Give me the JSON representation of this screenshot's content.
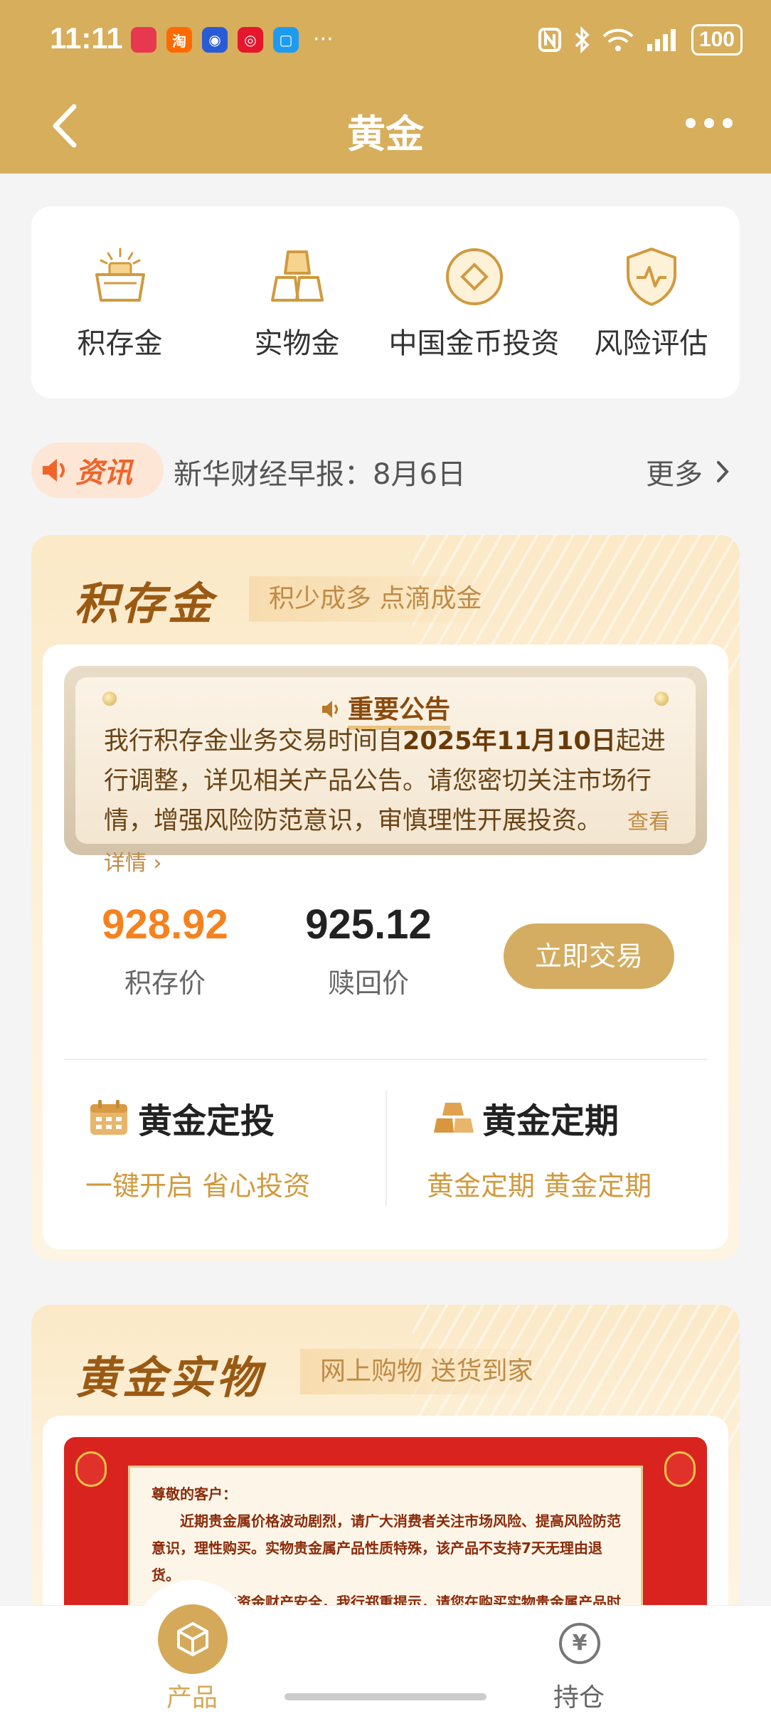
{
  "status_bar": {
    "time": "11:11",
    "apps": [
      {
        "icon": "huawei-app-icon",
        "glyph": "",
        "color": "#e8384f"
      },
      {
        "icon": "taobao-icon",
        "glyph": "淘",
        "color": "#ff6a00"
      },
      {
        "icon": "baidu-icon",
        "glyph": "◉",
        "color": "#2a5bd7"
      },
      {
        "icon": "weibo-icon",
        "glyph": "◎",
        "color": "#e6162d"
      },
      {
        "icon": "message-icon",
        "glyph": "▢",
        "color": "#1e9bf0"
      }
    ],
    "overflow": "···",
    "battery": "100"
  },
  "header": {
    "title": "黄金"
  },
  "quick_menu": [
    {
      "label": "积存金",
      "icon": "gold-basket-icon"
    },
    {
      "label": "实物金",
      "icon": "gold-bars-icon"
    },
    {
      "label": "中国金币投资",
      "icon": "gold-coin-icon"
    },
    {
      "label": "风险评估",
      "icon": "shield-pulse-icon"
    }
  ],
  "news": {
    "tag": "资讯",
    "headline": "新华财经早报：8月6日",
    "more": "更多"
  },
  "accumulation": {
    "title": "积存金",
    "subtitle": "积少成多 点滴成金",
    "notice": {
      "title": "重要公告",
      "text_before": "我行积存金业务交易时间自",
      "text_bold": "2025年11月10日",
      "text_after": "起进行调整，详见相关产品公告。请您密切关注市场行情，增强风险防范意识，审慎理性开展投资。",
      "link": "查看详情"
    },
    "buy_price": "928.92",
    "buy_label": "积存价",
    "redeem_price": "925.12",
    "redeem_label": "赎回价",
    "trade_button": "立即交易",
    "fixed_invest": {
      "title": "黄金定投",
      "desc": "一键开启 省心投资"
    },
    "fixed_term": {
      "title": "黄金定期",
      "desc": "黄金定期 黄金定期"
    }
  },
  "physical": {
    "title": "黄金实物",
    "subtitle": "网上购物 送货到家",
    "banner": {
      "greeting": "尊敬的客户：",
      "para1": "近期贵金属价格波动剧烈，请广大消费者关注市场风险、提高风险防范意识，理性购买。实物贵金属产品性质特殊，该产品不支持7天无理由退货。",
      "para2": "为了您的资金财产安全，我行郑重提示，请您在购买实物贵金属产品时勿轻信第三方未经查证信息的引导。您通过线上渠道购买的实"
    }
  },
  "tabbar": {
    "products": "产品",
    "holdings": "持仓",
    "holdings_glyph": "¥"
  },
  "colors": {
    "gold": "#d7ae5c",
    "accent_orange": "#f5821f",
    "brown": "#9a5a14"
  }
}
